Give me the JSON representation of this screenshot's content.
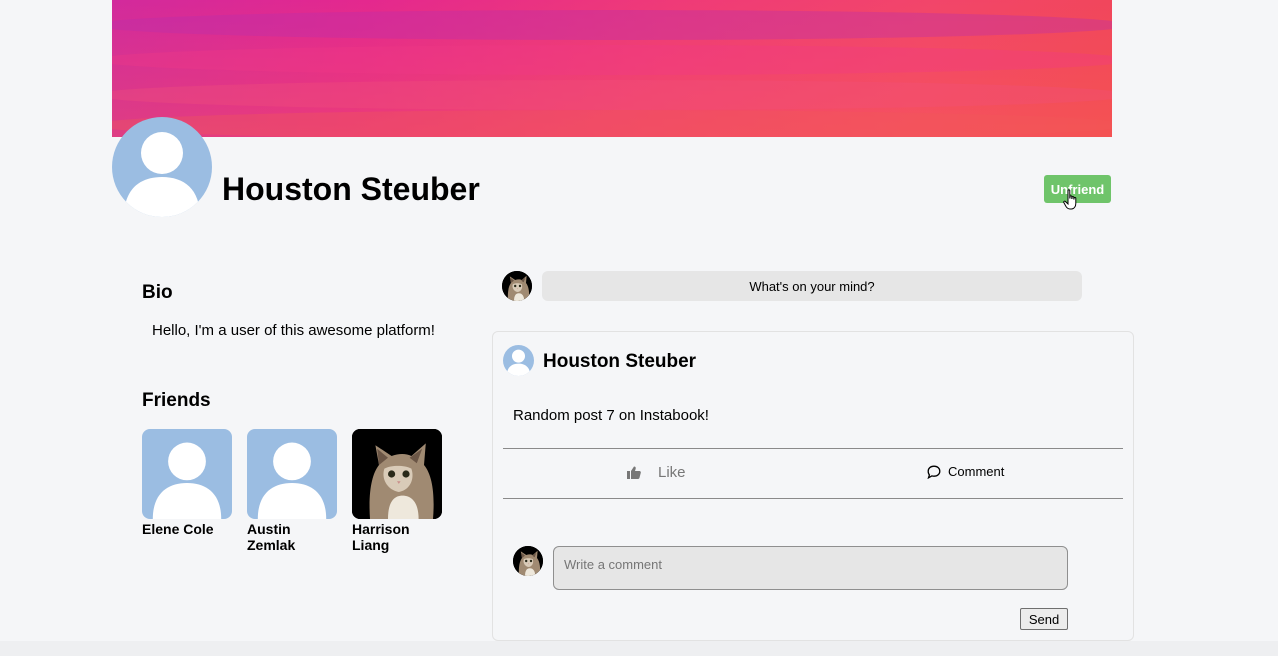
{
  "profile": {
    "name": "Houston Steuber",
    "unfriend_label": "Unfriend"
  },
  "bio": {
    "title": "Bio",
    "text": "Hello, I'm a user of this awesome platform!"
  },
  "friends": {
    "title": "Friends",
    "items": [
      {
        "name": "Elene Cole",
        "photo": "default-avatar"
      },
      {
        "name": "Austin Zemlak",
        "photo": "default-avatar"
      },
      {
        "name": "Harrison Liang",
        "photo": "cat-photo"
      }
    ]
  },
  "composer": {
    "prompt": "What's on your mind?"
  },
  "post": {
    "author": "Houston Steuber",
    "text": "Random post 7 on Instabook!",
    "like_label": "Like",
    "comment_label": "Comment",
    "comment_placeholder": "Write a comment",
    "send_label": "Send"
  },
  "colors": {
    "avatar_bg": "#9bbde2",
    "unfriend_bg": "#6fc46a",
    "cover_gradient": [
      "#d22a9c",
      "#f1465a"
    ]
  }
}
